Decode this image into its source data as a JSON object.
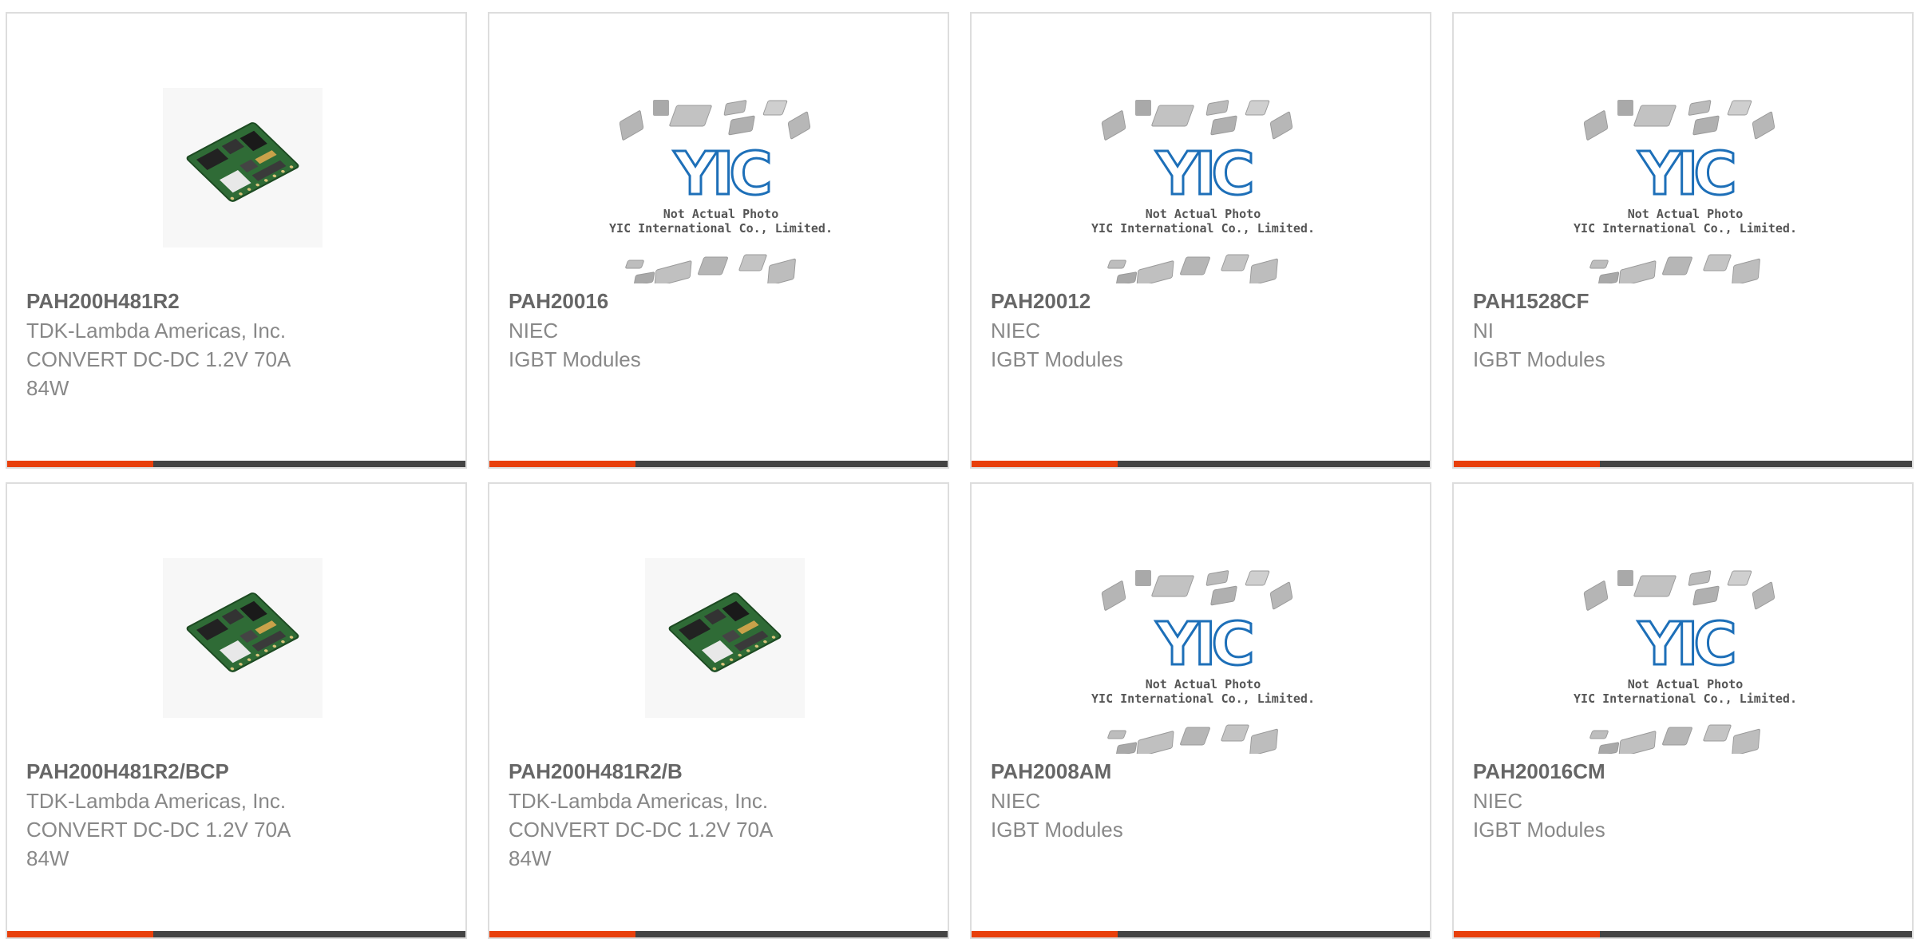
{
  "accent_color": "#e8400c",
  "bar_color": "#444444",
  "placeholder": {
    "line1": "Not Actual Photo",
    "line2": "YIC International Co., Limited.",
    "logo": "YIC"
  },
  "products": [
    {
      "part_number": "PAH200H481R2",
      "manufacturer": "TDK-Lambda Americas, Inc.",
      "description": "CONVERT DC-DC 1.2V 70A\n84W",
      "image": "pcb-board-photo"
    },
    {
      "part_number": "PAH20016",
      "manufacturer": "NIEC",
      "description": "IGBT Modules",
      "image": "not-actual-photo-placeholder"
    },
    {
      "part_number": "PAH20012",
      "manufacturer": "NIEC",
      "description": "IGBT Modules",
      "image": "not-actual-photo-placeholder"
    },
    {
      "part_number": "PAH1528CF",
      "manufacturer": "NI",
      "description": "IGBT Modules",
      "image": "not-actual-photo-placeholder"
    },
    {
      "part_number": "PAH200H481R2/BCP",
      "manufacturer": "TDK-Lambda Americas, Inc.",
      "description": "CONVERT DC-DC 1.2V 70A\n84W",
      "image": "pcb-board-photo"
    },
    {
      "part_number": "PAH200H481R2/B",
      "manufacturer": "TDK-Lambda Americas, Inc.",
      "description": "CONVERT DC-DC 1.2V 70A\n84W",
      "image": "pcb-board-photo"
    },
    {
      "part_number": "PAH2008AM",
      "manufacturer": "NIEC",
      "description": "IGBT Modules",
      "image": "not-actual-photo-placeholder"
    },
    {
      "part_number": "PAH20016CM",
      "manufacturer": "NIEC",
      "description": "IGBT Modules",
      "image": "not-actual-photo-placeholder"
    }
  ]
}
